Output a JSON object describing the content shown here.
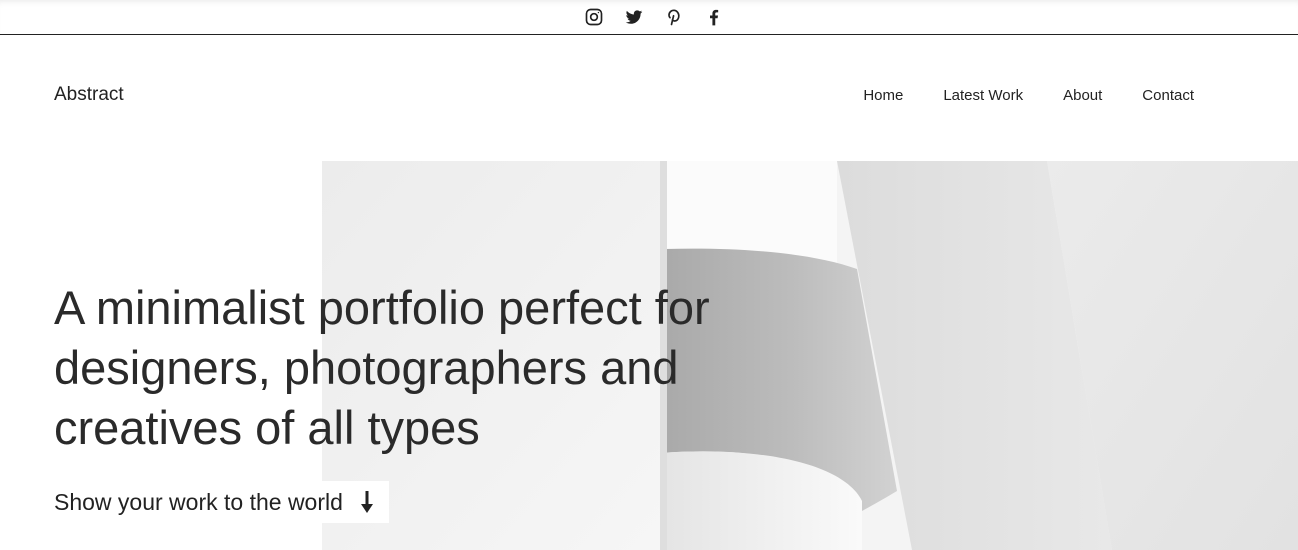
{
  "social": {
    "icons": [
      "instagram-icon",
      "twitter-icon",
      "pinterest-icon",
      "facebook-icon"
    ]
  },
  "header": {
    "brand": "Abstract",
    "nav": [
      "Home",
      "Latest Work",
      "About",
      "Contact"
    ]
  },
  "hero": {
    "headline_lines": [
      "A minimalist portfolio perfect for",
      "designers, photographers and",
      "creatives of all types"
    ],
    "cta_label": "Show your work to the world",
    "cta_icon": "arrow-down-icon"
  },
  "colors": {
    "text": "#222222",
    "background": "#ffffff"
  }
}
